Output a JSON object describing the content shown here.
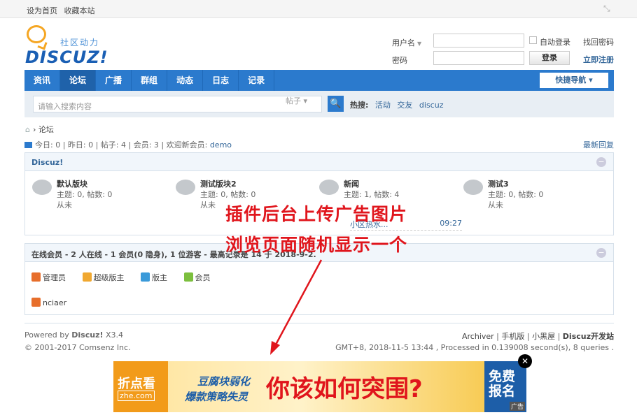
{
  "topbar": {
    "set_home": "设为首页",
    "bookmark": "收藏本站"
  },
  "logo": {
    "slogan": "社区动力",
    "word": "DISCUZ!"
  },
  "login": {
    "username_label": "用户名",
    "password_label": "密码",
    "auto_login": "自动登录",
    "forgot": "找回密码",
    "login_button": "登录",
    "register": "立即注册"
  },
  "nav": {
    "items": [
      "资讯",
      "论坛",
      "广播",
      "群组",
      "动态",
      "日志",
      "记录"
    ],
    "active": 1,
    "quick": "快捷导航 ▾"
  },
  "search": {
    "placeholder": "请输入搜索内容",
    "type": "帖子",
    "hot_label": "热搜:",
    "hot": [
      "活动",
      "交友",
      "discuz"
    ]
  },
  "breadcrumb": {
    "current": "论坛"
  },
  "stats": {
    "text": "今日: 0 | 昨日: 0 | 帖子: 4 | 会员: 3 | 欢迎新会员: ",
    "new_member": "demo",
    "latest": "最新回复"
  },
  "forum_group": {
    "title": "Discuz!",
    "forums": [
      {
        "name": "默认版块",
        "info": "主题: 0, 帖数: 0",
        "last": "从未"
      },
      {
        "name": "测试版块2",
        "info": "主题: 0, 帖数: 0",
        "last": "从未"
      },
      {
        "name": "新闻",
        "info": "主题: 1, 帖数: 4",
        "last": "",
        "lastlink": "小区热水..."
      },
      {
        "name": "测试3",
        "info": "主题: 0, 帖数: 0",
        "last": "从未"
      }
    ],
    "last_time": "09:27"
  },
  "online": {
    "title": "在线会员 - 2 人在线 - 1 会员(0 隐身), 1 位游客 - 最高记录是 14 于 2018-9-2.",
    "legend": [
      {
        "label": "管理员",
        "color": "#e76e2b"
      },
      {
        "label": "超级版主",
        "color": "#f0a830"
      },
      {
        "label": "版主",
        "color": "#3a9ad9"
      },
      {
        "label": "会员",
        "color": "#7cbf3e"
      }
    ],
    "user": "nciaer"
  },
  "footer": {
    "powered": "Powered by ",
    "brand": "Discuz!",
    "version": " X3.4",
    "copyright": "© 2001-2017 Comsenz Inc.",
    "links": [
      "Archiver",
      "手机版",
      "小黑屋"
    ],
    "dev": "Discuz开发站",
    "time": "GMT+8, 2018-11-5 13:44 , Processed in 0.139008 second(s), 8 queries ."
  },
  "overlay": {
    "line1": "插件后台上传广告图片",
    "line2": "浏览页面随机显示一个"
  },
  "ad": {
    "brand": "折点看",
    "brand_sub": "zhe.com",
    "slogan1": "豆腐块弱化",
    "slogan2": "爆款策略失灵",
    "headline": "你该如何突围?",
    "cta": "免费报名",
    "tag": "广告"
  },
  "colors": {
    "nav": "#2b7acd",
    "link": "#336699",
    "overlay": "#e0151c",
    "ad_orange": "#f29b1a"
  }
}
